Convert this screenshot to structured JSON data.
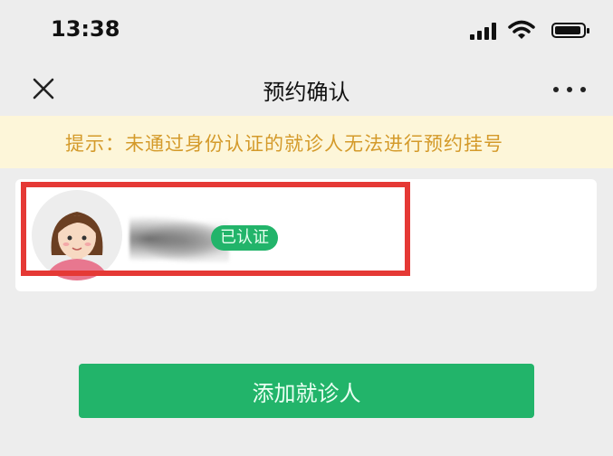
{
  "status_bar": {
    "time": "13:38"
  },
  "nav": {
    "title": "预约确认"
  },
  "notice": {
    "text": "提示：未通过身份认证的就诊人无法进行预约挂号"
  },
  "patient": {
    "badge": "已认证"
  },
  "actions": {
    "add_patient_label": "添加就诊人"
  },
  "colors": {
    "accent_green": "#22b46a",
    "notice_text": "#d49a2a",
    "notice_bg": "#fdf6d9",
    "highlight_red": "#e53935",
    "page_bg": "#ededed"
  },
  "icons": [
    "signal-icon",
    "wifi-icon",
    "battery-icon",
    "close-icon",
    "more-icon",
    "avatar"
  ]
}
